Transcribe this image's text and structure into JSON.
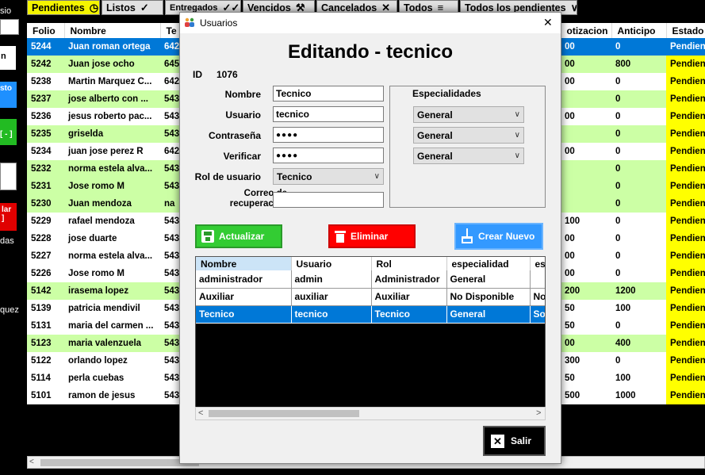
{
  "filter_tabs": [
    {
      "label": "Pendientes",
      "icon": "clock-icon",
      "glyph": "◷"
    },
    {
      "label": "Listos",
      "icon": "check-icon",
      "glyph": "✓"
    },
    {
      "label": "Entregados",
      "icon": "double-check-icon",
      "glyph": "✓✓"
    },
    {
      "label": "Vencidos",
      "icon": "gavel-icon",
      "glyph": "⚒"
    },
    {
      "label": "Cancelados",
      "icon": "x-icon",
      "glyph": "✕"
    },
    {
      "label": "Todos",
      "icon": "list-icon",
      "glyph": "≡"
    },
    {
      "label": "Todos los pendientes",
      "icon": "chevron-down-icon",
      "glyph": "∨"
    }
  ],
  "left_panel": {
    "partial_top": "sio",
    "btn_blue_text": "sto",
    "btn_green_text": "[ - ]",
    "btn_red_text": "lar\n]",
    "partial_das": "das",
    "partial_quez": "quez"
  },
  "main_table": {
    "headers": [
      "Folio",
      "Nombre",
      "Te",
      "otizacion",
      "Anticipo",
      "Estado"
    ],
    "rows": [
      {
        "folio": "5244",
        "nombre": "Juan roman ortega",
        "tel": "642",
        "cot": "00",
        "anticipo": "0",
        "estado": "Pendiente",
        "style": "sel"
      },
      {
        "folio": "5242",
        "nombre": "Juan jose ocho",
        "tel": "645",
        "cot": "00",
        "anticipo": "800",
        "estado": "Pendiente",
        "style": "g"
      },
      {
        "folio": "5238",
        "nombre": "Martin Marquez C...",
        "tel": "642",
        "cot": "00",
        "anticipo": "0",
        "estado": "Pendiente",
        "style": "w"
      },
      {
        "folio": "5237",
        "nombre": "jose alberto con ...",
        "tel": "543",
        "cot": "",
        "anticipo": "0",
        "estado": "Pendiente",
        "style": "g"
      },
      {
        "folio": "5236",
        "nombre": "jesus roberto pac...",
        "tel": "543",
        "cot": "00",
        "anticipo": "0",
        "estado": "Pendiente",
        "style": "w"
      },
      {
        "folio": "5235",
        "nombre": "griselda",
        "tel": "543",
        "cot": "",
        "anticipo": "0",
        "estado": "Pendiente",
        "style": "g"
      },
      {
        "folio": "5234",
        "nombre": "juan jose perez R",
        "tel": "642",
        "cot": "00",
        "anticipo": "0",
        "estado": "Pendiente",
        "style": "w"
      },
      {
        "folio": "5232",
        "nombre": "norma estela alva...",
        "tel": "543",
        "cot": "",
        "anticipo": "0",
        "estado": "Pendiente",
        "style": "g"
      },
      {
        "folio": "5231",
        "nombre": "Jose romo M",
        "tel": "543",
        "cot": "",
        "anticipo": "0",
        "estado": "Pendiente",
        "style": "g"
      },
      {
        "folio": "5230",
        "nombre": "Juan mendoza",
        "tel": "na",
        "cot": "",
        "anticipo": "0",
        "estado": "Pendiente",
        "style": "g"
      },
      {
        "folio": "5229",
        "nombre": "rafael mendoza",
        "tel": "543",
        "cot": "100",
        "anticipo": "0",
        "estado": "Pendiente",
        "style": "w"
      },
      {
        "folio": "5228",
        "nombre": "jose duarte",
        "tel": "543",
        "cot": "00",
        "anticipo": "0",
        "estado": "Pendiente",
        "style": "w"
      },
      {
        "folio": "5227",
        "nombre": "norma estela alva...",
        "tel": "543",
        "cot": "00",
        "anticipo": "0",
        "estado": "Pendiente",
        "style": "w"
      },
      {
        "folio": "5226",
        "nombre": "Jose romo M",
        "tel": "543",
        "cot": "00",
        "anticipo": "0",
        "estado": "Pendiente",
        "style": "w"
      },
      {
        "folio": "5142",
        "nombre": "irasema lopez",
        "tel": "543",
        "cot": "200",
        "anticipo": "1200",
        "estado": "Pendiente",
        "style": "g"
      },
      {
        "folio": "5139",
        "nombre": "patricia mendivil",
        "tel": "543",
        "cot": "50",
        "anticipo": "100",
        "estado": "Pendiente",
        "style": "w"
      },
      {
        "folio": "5131",
        "nombre": "maria del carmen ...",
        "tel": "543",
        "cot": "50",
        "anticipo": "0",
        "estado": "Pendiente",
        "style": "w"
      },
      {
        "folio": "5123",
        "nombre": "maria valenzuela",
        "tel": "543",
        "cot": "00",
        "anticipo": "400",
        "estado": "Pendiente",
        "style": "g"
      },
      {
        "folio": "5122",
        "nombre": "orlando lopez",
        "tel": "543",
        "cot": "300",
        "anticipo": "0",
        "estado": "Pendiente",
        "style": "w"
      },
      {
        "folio": "5114",
        "nombre": "perla cuebas",
        "tel": "543",
        "cot": "50",
        "anticipo": "100",
        "estado": "Pendiente",
        "style": "w"
      },
      {
        "folio": "5101",
        "nombre": "ramon de jesus",
        "tel": "543",
        "cot": "500",
        "anticipo": "1000",
        "estado": "Pendiente",
        "style": "w"
      }
    ]
  },
  "dialog": {
    "window_title": "Usuarios",
    "close_glyph": "✕",
    "heading": "Editando - tecnico",
    "id_label": "ID",
    "id_value": "1076",
    "form": {
      "nombre_label": "Nombre",
      "nombre_value": "Tecnico",
      "usuario_label": "Usuario",
      "usuario_value": "tecnico",
      "contrasena_label": "Contraseña",
      "contrasena_value": "●●●●",
      "verificar_label": "Verificar",
      "verificar_value": "●●●●",
      "rol_label": "Rol de usuario",
      "rol_value": "Tecnico",
      "correo_label": "Correo de\nrecuperación",
      "correo_value": ""
    },
    "especialidades": {
      "title": "Especialidades",
      "values": [
        "General",
        "General",
        "General"
      ]
    },
    "buttons": {
      "actualizar": "Actualizar",
      "eliminar": "Eliminar",
      "crear_nuevo": "Crear Nuevo",
      "salir": "Salir"
    },
    "colors": {
      "actualizar": "#33cc33",
      "eliminar": "#ff0000",
      "crear_nuevo": "#3399ff"
    },
    "grid": {
      "headers": [
        "Nombre",
        "Usuario",
        "Rol",
        "especialidad",
        "es"
      ],
      "rows": [
        {
          "cells": [
            "administrador",
            "admin",
            "Administrador",
            "General",
            ""
          ],
          "selected": false
        },
        {
          "cells": [
            "Auxiliar",
            "auxiliar",
            "Auxiliar",
            "No Disponible",
            "No"
          ],
          "selected": false
        },
        {
          "cells": [
            "Tecnico",
            "tecnico",
            "Tecnico",
            "General",
            "So"
          ],
          "selected": true
        }
      ]
    }
  }
}
